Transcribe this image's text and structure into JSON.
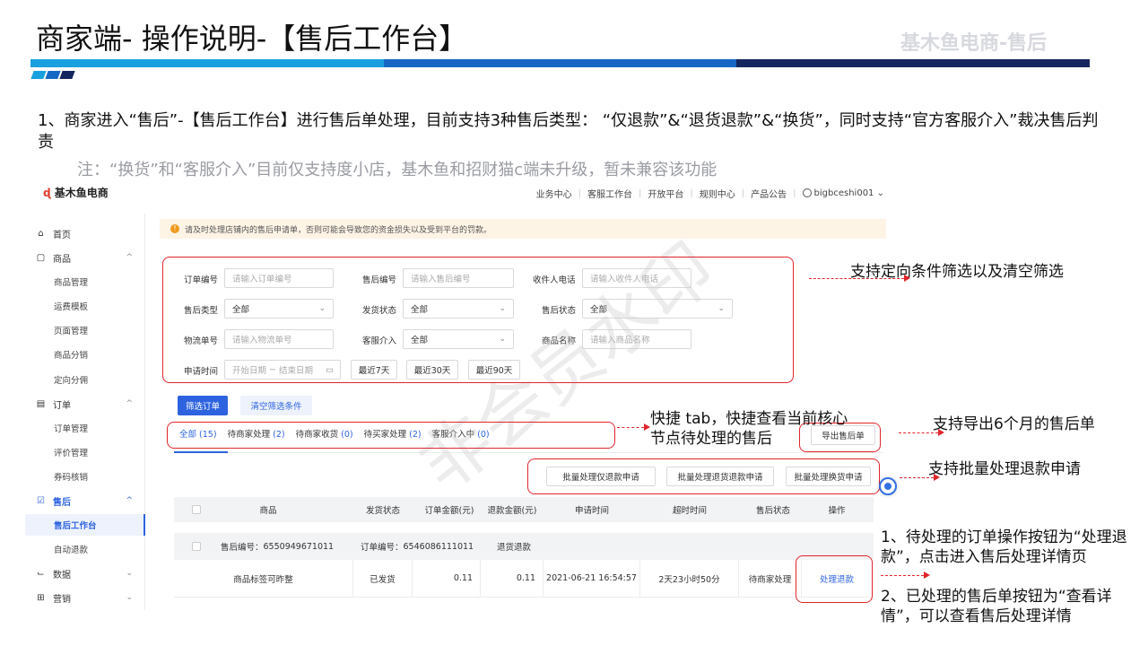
{
  "slide": {
    "title": "商家端- 操作说明-【售后工作台】",
    "brand": "基木鱼电商-售后",
    "intro": "1、商家进入“售后”-【售后工作台】进行售后单处理，目前支持3种售后类型：   “仅退款”&“退货退款”&“换货”，同时支持“官方客服介入”裁决售后判责",
    "note": "注：“换货”和“客服介入”目前仅支持度小店，基木鱼和招财猫c端未升级，暂未兼容该功能",
    "watermark": "非会员水印"
  },
  "app": {
    "logo_mark": "ɖ",
    "logo_text": "基木鱼电商",
    "topnav": [
      "业务中心",
      "客服工作台",
      "开放平台",
      "规则中心",
      "产品公告"
    ],
    "user": "bigbceshi001",
    "sidebar": {
      "home": "首页",
      "goods": "商品",
      "goods_items": [
        "商品管理",
        "运费模板",
        "页面管理",
        "商品分销",
        "定向分佣"
      ],
      "order": "订单",
      "order_items": [
        "订单管理",
        "评价管理",
        "券码核销"
      ],
      "aftersale": "售后",
      "aftersale_items": [
        "售后工作台",
        "自动退款"
      ],
      "data": "数据",
      "marketing": "营销"
    },
    "warning": "请及时处理店铺内的售后申请单，否则可能会导致您的资金损失以及受到平台的罚款。",
    "filters": {
      "order_no_label": "订单编号",
      "order_no_ph": "请输入订单编号",
      "after_no_label": "售后编号",
      "after_no_ph": "请输入售后编号",
      "phone_label": "收件人电话",
      "phone_ph": "请输入收件人电话",
      "type_label": "售后类型",
      "type_value": "全部",
      "ship_label": "发货状态",
      "ship_value": "全部",
      "status_label": "售后状态",
      "status_value": "全部",
      "logistics_label": "物流单号",
      "logistics_ph": "请输入物流单号",
      "cs_label": "客服介入",
      "cs_value": "全部",
      "goods_name_label": "商品名称",
      "goods_name_ph": "请输入商品名称",
      "time_label": "申请时间",
      "time_start": "开始日期",
      "time_sep": "~",
      "time_end": "结束日期",
      "last7": "最近7天",
      "last30": "最近30天",
      "last90": "最近90天"
    },
    "filter_btn": "筛选订单",
    "clear_btn": "清空筛选条件",
    "tabs": [
      {
        "label": "全部",
        "count": "(15)"
      },
      {
        "label": "待商家处理",
        "count": "(2)"
      },
      {
        "label": "待商家收货",
        "count": "(0)"
      },
      {
        "label": "待买家处理",
        "count": "(2)"
      },
      {
        "label": "客服介入中",
        "count": "(0)"
      }
    ],
    "export_btn": "导出售后单",
    "batch_btns": [
      "批量处理仅退款申请",
      "批量处理退货退款申请",
      "批量处理换货申请"
    ],
    "table": {
      "headers": [
        "商品",
        "发货状态",
        "订单金额(元)",
        "退款金额(元)",
        "申请时间",
        "超时时间",
        "售后状态",
        "操作"
      ],
      "group": {
        "after_label": "售后编号：",
        "after_no": "6550949671011",
        "order_label": "订单编号：",
        "order_no": "6546086111011",
        "type": "退货退款"
      },
      "row": {
        "goods": "商品标签可昨整",
        "ship": "已发货",
        "order_amount": "0.11",
        "refund": "0.11",
        "apply_time": "2021-06-21 16:54:57",
        "timeout": "2天23小时50分",
        "status": "待商家处理",
        "action": "处理退款"
      }
    }
  },
  "annotations": {
    "filter": "支持定向条件筛选以及清空筛选",
    "tabs_line1": "快捷 tab，快捷查看当前核心",
    "tabs_line2": "节点待处理的售后",
    "export": "支持导出6个月的售后单",
    "batch": "支持批量处理退款申请",
    "process1": "1、待处理的订单操作按钮为“处理退款”，点击进入售后处理详情页",
    "process2": "2、已处理的售后单按钮为“查看详情”，可以查看售后处理详情"
  }
}
